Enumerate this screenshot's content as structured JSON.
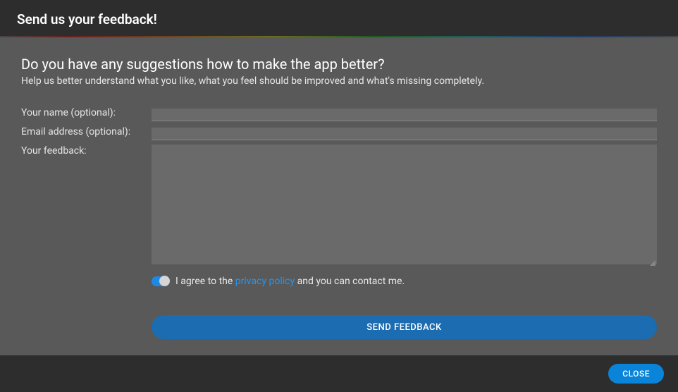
{
  "header": {
    "title": "Send us your feedback!"
  },
  "body": {
    "question": "Do you have any suggestions how to make the app better?",
    "subtitle": "Help us better understand what you like, what you feel should be improved and what's missing completely.",
    "labels": {
      "name": "Your name (optional):",
      "email": "Email address (optional):",
      "feedback": "Your feedback:"
    },
    "values": {
      "name": "",
      "email": "",
      "feedback": ""
    },
    "agree": {
      "prefix": "I agree to the ",
      "link": "privacy policy",
      "suffix": " and you can contact me.",
      "toggled": true
    },
    "sendButton": "SEND FEEDBACK"
  },
  "footer": {
    "closeButton": "CLOSE"
  }
}
